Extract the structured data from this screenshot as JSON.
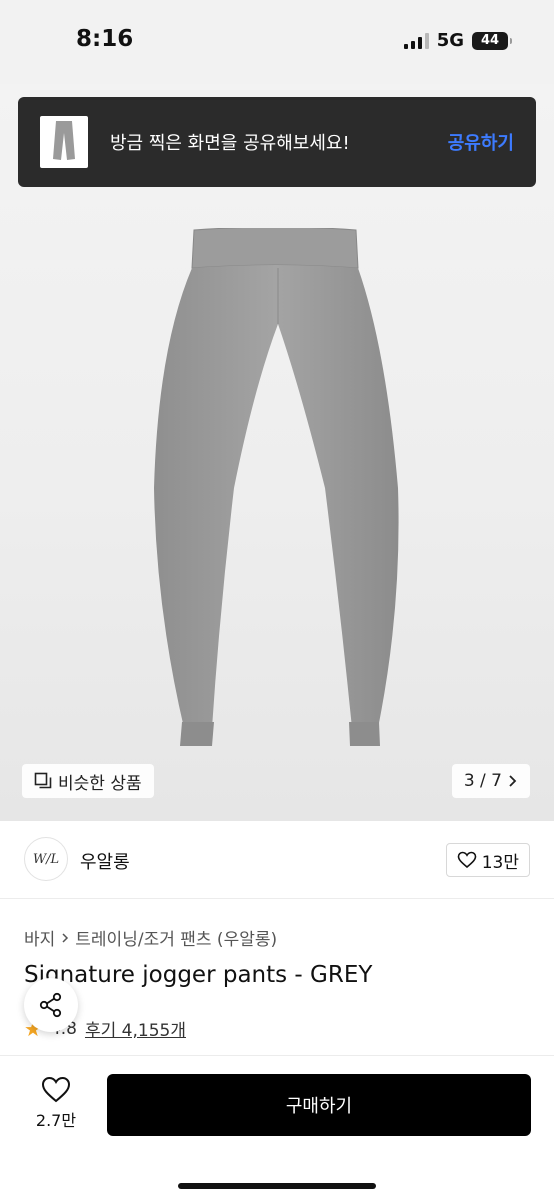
{
  "status_bar": {
    "time": "8:16",
    "network": "5G",
    "battery": "44"
  },
  "toast": {
    "message": "방금 찍은 화면을 공유해보세요!",
    "action": "공유하기",
    "action_color": "#3d7bff"
  },
  "gallery": {
    "similar_label": "비슷한 상품",
    "page_indicator": "3 / 7"
  },
  "brand": {
    "logo_text": "W/L",
    "name": "우알롱",
    "like_count": "13만"
  },
  "product": {
    "breadcrumb": [
      "바지",
      "트레이닝/조거 팬츠 (우알롱)"
    ],
    "title": "Signature jogger pants - GREY",
    "rating": "4.8",
    "review_label": "후기 4,155개"
  },
  "bottom": {
    "wish_count": "2.7만",
    "buy_label": "구매하기"
  }
}
